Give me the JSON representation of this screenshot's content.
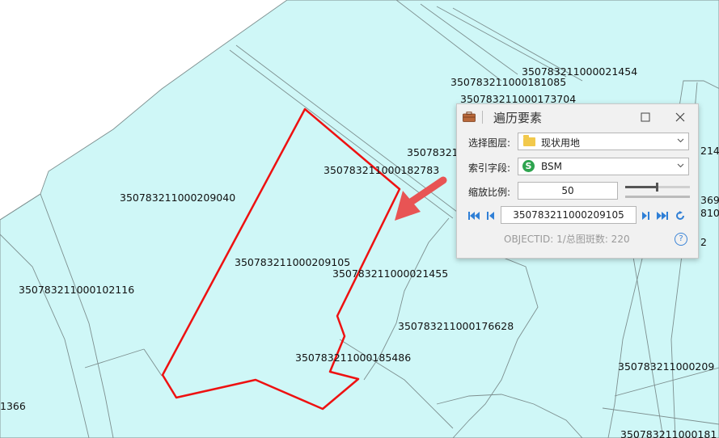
{
  "map": {
    "labels": {
      "l1": "350783211000021454",
      "l2": "350783211000181085",
      "l3": "350783211000173704",
      "l4": "350783211000182783",
      "l5": "350783211000209040",
      "l6": "350783211000209105",
      "l7": "350783211000021455",
      "l8": "350783211000102116",
      "l9": "350783211000176628",
      "l10": "350783211000185486",
      "l11": "350783211000209",
      "l12": "350783211000181",
      "l13": "1366",
      "l14": "35078321",
      "l15": "214",
      "l16": "369",
      "l17": "810",
      "l18": "2"
    },
    "colors": {
      "parcel_fill": "#cff7f7",
      "parcel_stroke": "#7d8f8f",
      "highlight": "#ee1111",
      "arrow": "#e85454"
    }
  },
  "dialog": {
    "title": "遍历要素",
    "title_icon": "toolbox-icon",
    "layer_label": "选择图层:",
    "layer_value": "现状用地",
    "field_label": "索引字段:",
    "field_value": "BSM",
    "zoom_label": "缩放比例:",
    "zoom_value": "50",
    "zoom_slider_level": 0.5,
    "current_id": "350783211000209105",
    "status": "OBJECTID:  1/总图斑数:  220",
    "help": "?"
  }
}
